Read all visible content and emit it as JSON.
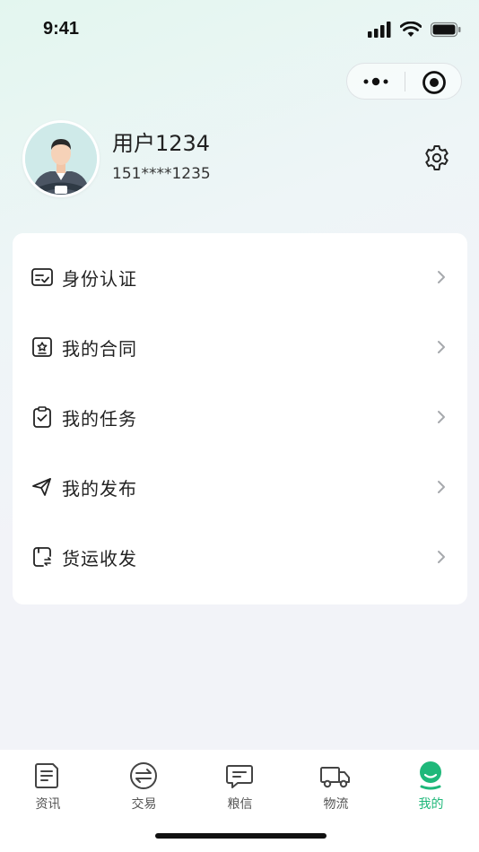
{
  "status_bar": {
    "time": "9:41"
  },
  "profile": {
    "username": "用户1234",
    "phone": "151****1235"
  },
  "menu": [
    {
      "label": "身份认证",
      "icon": "id-card-icon"
    },
    {
      "label": "我的合同",
      "icon": "contract-icon"
    },
    {
      "label": "我的任务",
      "icon": "task-clipboard-icon"
    },
    {
      "label": "我的发布",
      "icon": "send-icon"
    },
    {
      "label": "货运收发",
      "icon": "freight-icon"
    }
  ],
  "tabs": [
    {
      "label": "资讯",
      "icon": "news-icon"
    },
    {
      "label": "交易",
      "icon": "exchange-icon"
    },
    {
      "label": "粮信",
      "icon": "message-icon"
    },
    {
      "label": "物流",
      "icon": "truck-icon"
    },
    {
      "label": "我的",
      "icon": "profile-icon",
      "active": true
    }
  ],
  "colors": {
    "accent": "#1fb87a",
    "background": "#f2f3f8"
  }
}
